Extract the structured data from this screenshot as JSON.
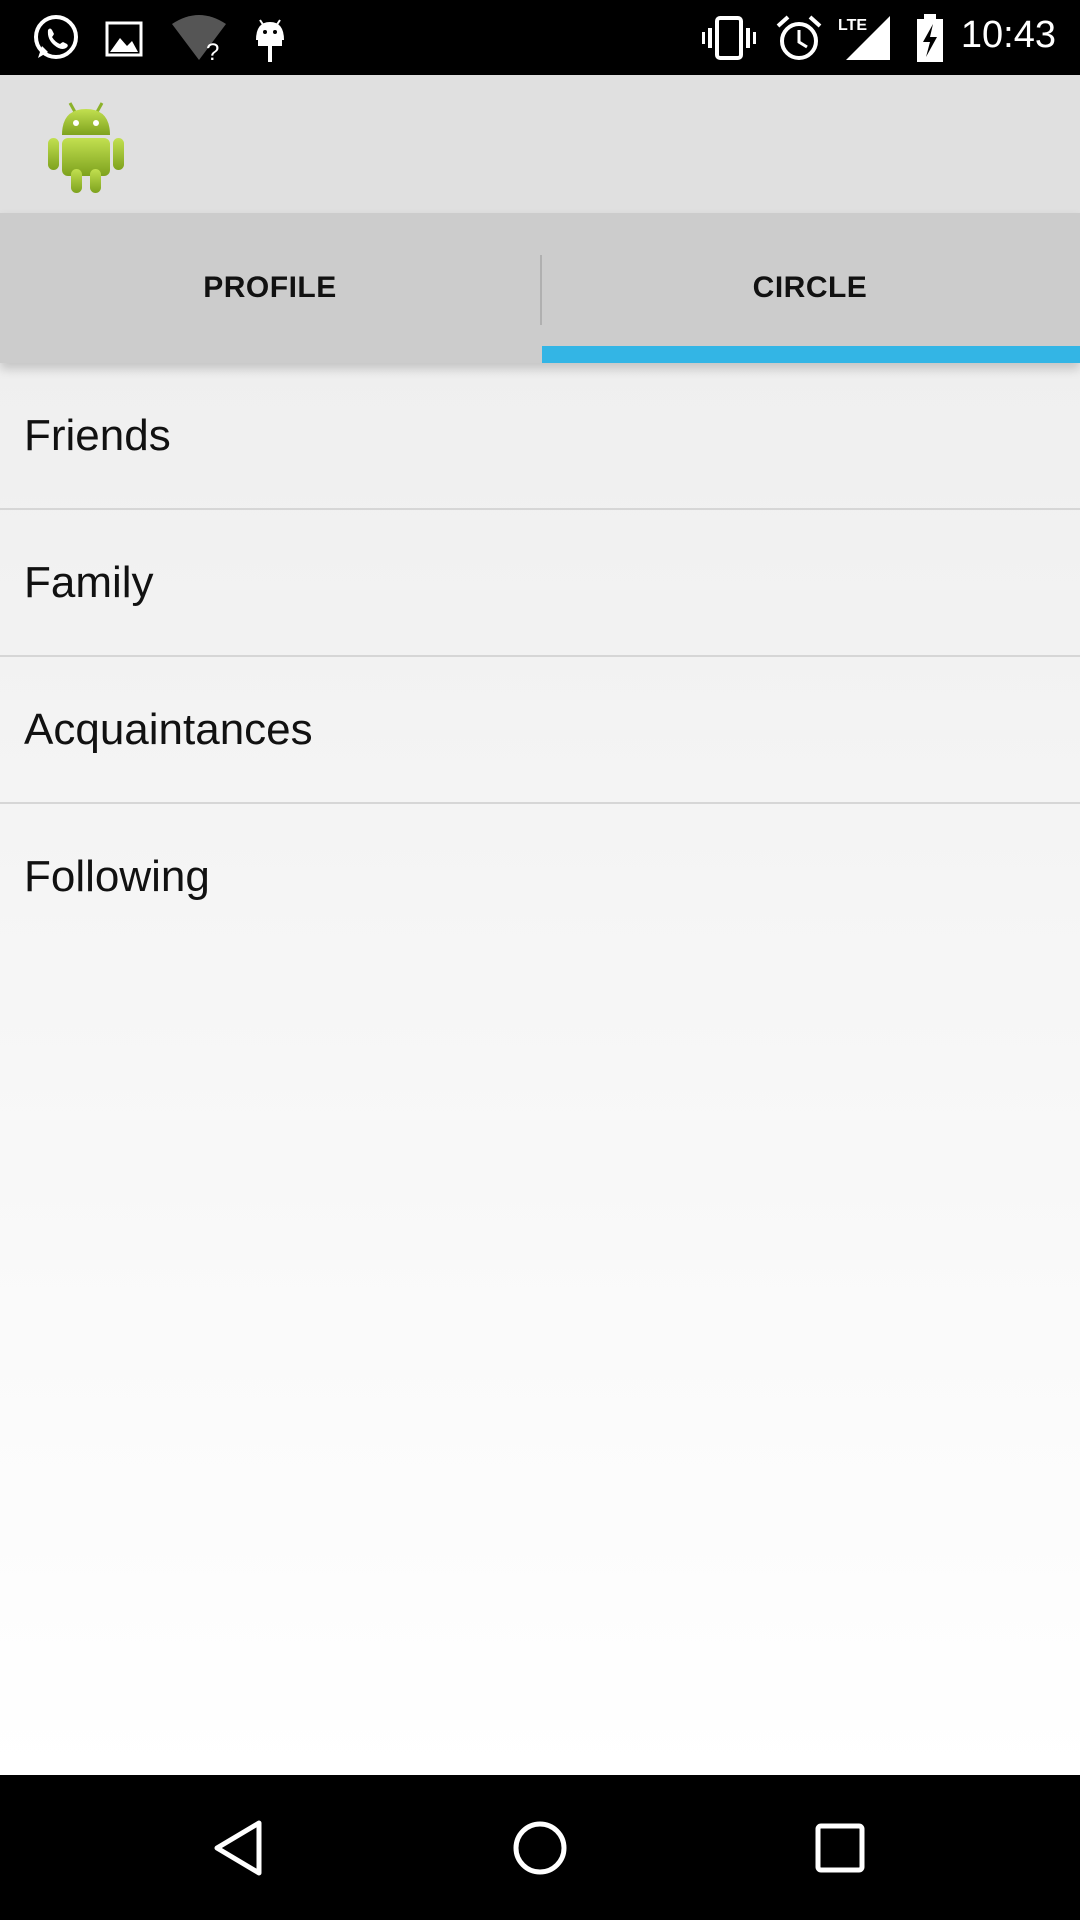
{
  "status_bar": {
    "time": "10:43",
    "left_icons": [
      "whatsapp-icon",
      "image-icon",
      "wifi-unknown-icon",
      "android-debug-icon"
    ],
    "right_icons": [
      "vibrate-icon",
      "alarm-icon",
      "lte-signal-icon",
      "battery-charging-icon"
    ],
    "lte_label": "LTE"
  },
  "action_bar": {
    "logo": "android-logo-icon",
    "logo_color": "#a4c639"
  },
  "tabs": [
    {
      "label": "PROFILE",
      "selected": false
    },
    {
      "label": "CIRCLE",
      "selected": true
    }
  ],
  "tab_indicator_color": "#33b5e5",
  "list": {
    "items": [
      {
        "label": "Friends"
      },
      {
        "label": "Family"
      },
      {
        "label": "Acquaintances"
      },
      {
        "label": "Following"
      }
    ]
  },
  "nav_bar": {
    "buttons": [
      "back-icon",
      "home-icon",
      "recents-icon"
    ]
  }
}
